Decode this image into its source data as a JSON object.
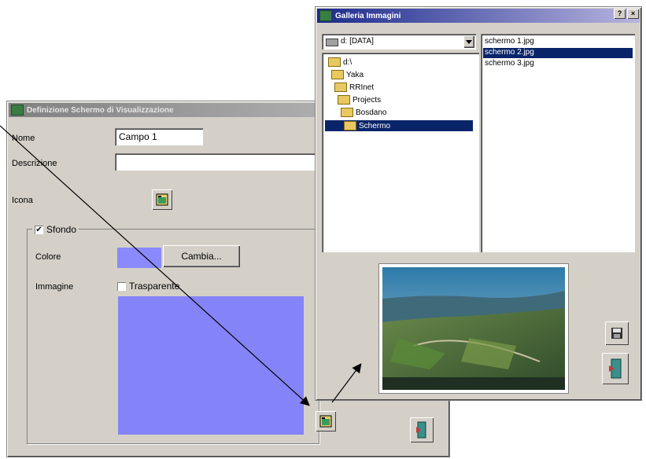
{
  "definition_window": {
    "title": "Definizione Schermo di Visualizzazione",
    "name_label": "Nome",
    "name_value": "Campo 1",
    "description_label": "Descrizione",
    "description_value": "",
    "icon_label": "Icona",
    "background_checkbox_label": "Sfondo",
    "background_checked": true,
    "color_label": "Colore",
    "color_value": "#8a8afc",
    "change_button_label": "Cambia...",
    "image_label": "Immagine",
    "transparent_checkbox_label": "Trasparente",
    "transparent_checked": false,
    "image_preview_color": "#8484f8"
  },
  "gallery_window": {
    "title": "Galleria Immagini",
    "help_button_label": "?",
    "close_button_label": "×",
    "drive_select_value": "d: [DATA]",
    "folders": [
      {
        "label": "d:\\",
        "selected": false
      },
      {
        "label": "Yaka",
        "selected": false
      },
      {
        "label": "RRInet",
        "selected": false
      },
      {
        "label": "Projects",
        "selected": false
      },
      {
        "label": "Bosdano",
        "selected": false
      },
      {
        "label": "Schermo",
        "selected": true
      }
    ],
    "files": [
      {
        "label": "schermo 1.jpg",
        "selected": false
      },
      {
        "label": "schermo 2.jpg",
        "selected": true
      },
      {
        "label": "schermo 3.jpg",
        "selected": false
      }
    ]
  },
  "icons": {
    "app_icon": "app-icon",
    "image_picker_icon": "image-picker-icon",
    "save_icon": "floppy-disk-icon",
    "exit_icon": "exit-door-icon"
  },
  "colors": {
    "title_active": "#0a246a",
    "selection": "#0a246a",
    "window_bg": "#d4d0c8"
  }
}
